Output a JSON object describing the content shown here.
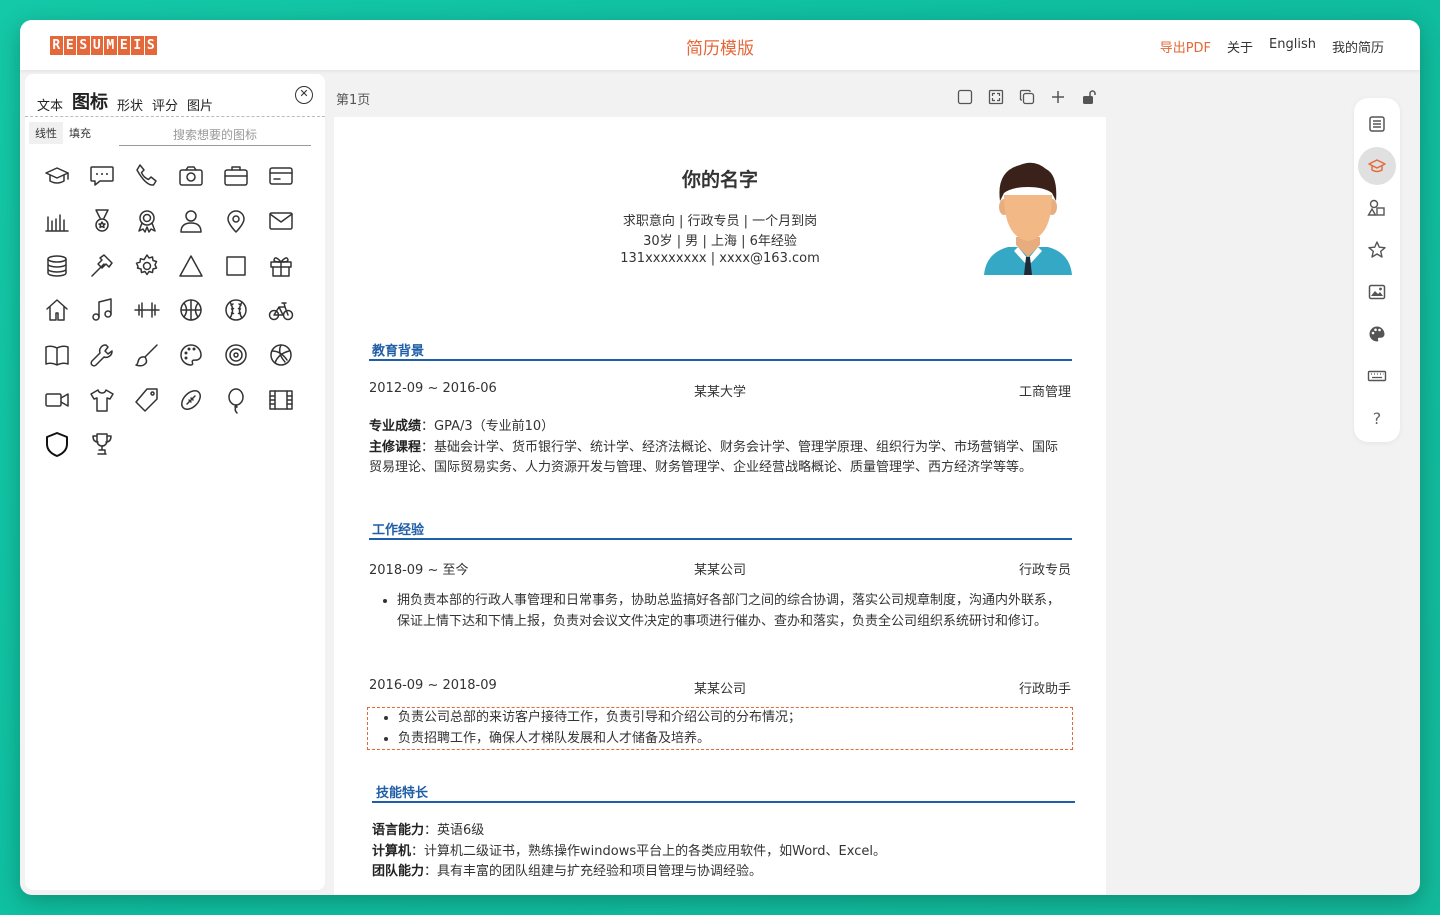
{
  "app": {
    "logo_letters": [
      "R",
      "E",
      "S",
      "U",
      "M",
      "E",
      "I",
      "S"
    ],
    "title": "简历模版",
    "nav": {
      "export": "导出PDF",
      "about": "关于",
      "language": "English",
      "my_resumes": "我的简历"
    }
  },
  "left_panel": {
    "tabs": [
      {
        "label": "文本"
      },
      {
        "label": "图标"
      },
      {
        "label": "形状"
      },
      {
        "label": "评分"
      },
      {
        "label": "图片"
      }
    ],
    "active_tab": "图标",
    "close_glyph": "✕",
    "subtabs": [
      "线性",
      "填充"
    ],
    "search_placeholder": "搜索想要的图标",
    "icons": [
      "graduation-cap",
      "chat-bubble",
      "phone",
      "camera",
      "briefcase",
      "credit-card",
      "bar-chart",
      "medal",
      "award-ribbon",
      "user",
      "location-pin",
      "mail",
      "database",
      "hammer",
      "gear",
      "triangle",
      "square",
      "gift",
      "home",
      "music-note",
      "dumbbell",
      "basketball",
      "baseball",
      "bicycle",
      "book",
      "wrench",
      "brush",
      "palette",
      "target",
      "volleyball",
      "video-camera",
      "t-shirt",
      "tag",
      "football",
      "balloon",
      "film",
      "shield",
      "trophy"
    ]
  },
  "toolbar": {
    "page_label": "第1页"
  },
  "resume": {
    "name": "你的名字",
    "intent": "求职意向 | 行政专员 | 一个月到岗",
    "basic": "30岁 | 男 | 上海 | 6年经验",
    "contact": "131xxxxxxxx | xxxx@163.com",
    "education": {
      "title": "教育背景",
      "date": "2012-09 ~ 2016-06",
      "school": "某某大学",
      "major": "工商管理",
      "grade_label": "专业成绩",
      "grade": "：GPA/3（专业前10）",
      "courses_label": "主修课程",
      "courses": "：基础会计学、货币银行学、统计学、经济法概论、财务会计学、管理学原理、组织行为学、市场营销学、国际贸易理论、国际贸易实务、人力资源开发与管理、财务管理学、企业经营战略概论、质量管理学、西方经济学等等。"
    },
    "work": {
      "title": "工作经验",
      "jobs": [
        {
          "date": "2018-09 ~ 至今",
          "company": "某某公司",
          "role": "行政专员",
          "bullets": [
            "拥负责本部的行政人事管理和日常事务，协助总监搞好各部门之间的综合协调，落实公司规章制度，沟通内外联系，保证上情下达和下情上报，负责对会议文件决定的事项进行催办、查办和落实，负责全公司组织系统研讨和修订。"
          ]
        },
        {
          "date": "2016-09 ~ 2018-09",
          "company": "某某公司",
          "role": "行政助手",
          "bullets": [
            "负责公司总部的来访客户接待工作，负责引导和介绍公司的分布情况；",
            "负责招聘工作，确保人才梯队发展和人才储备及培养。"
          ]
        }
      ]
    },
    "skills": {
      "title": "技能特长",
      "items": [
        {
          "label": "语言能力",
          "text": "：英语6级"
        },
        {
          "label": "计算机",
          "text": "：计算机二级证书，熟练操作windows平台上的各类应用软件，如Word、Excel。"
        },
        {
          "label": "团队能力",
          "text": "：具有丰富的团队组建与扩充经验和项目管理与协调经验。"
        }
      ]
    }
  },
  "right_toolbar": {
    "items": [
      "document-icon",
      "graduation-cap-icon",
      "shapes-icon",
      "star-badge-icon",
      "image-icon",
      "palette-icon",
      "keyboard-icon",
      "help-icon"
    ],
    "help_glyph": "?"
  },
  "colors": {
    "accent": "#e4683a",
    "section_blue": "#1f5ea8",
    "bg_teal": "#14c9a7"
  }
}
